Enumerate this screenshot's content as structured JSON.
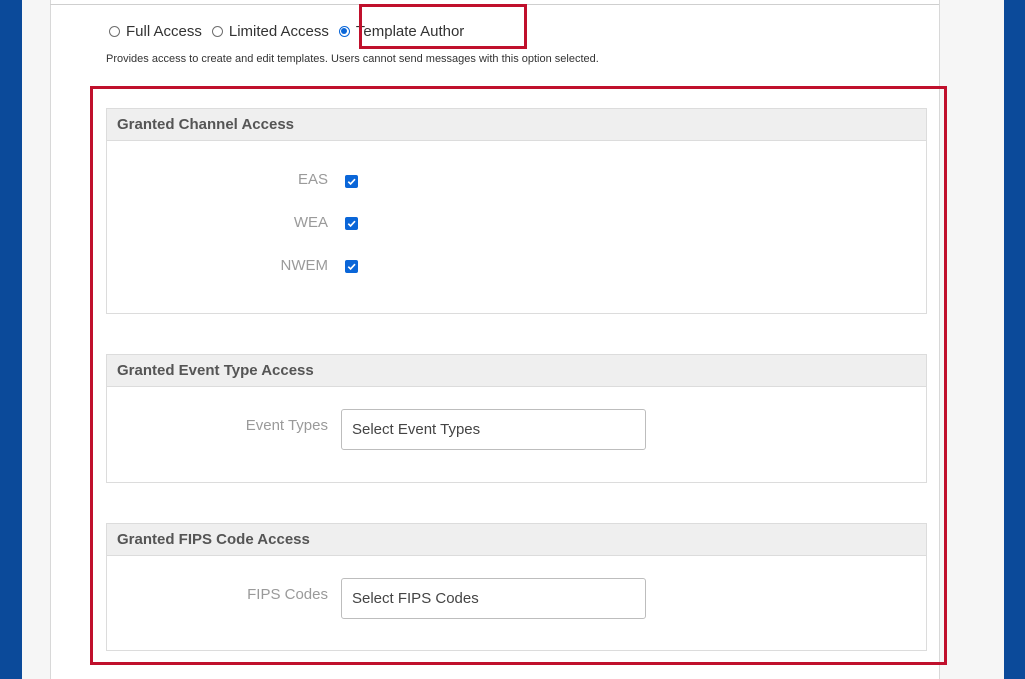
{
  "access_options": [
    {
      "label": "Full Access",
      "selected": false
    },
    {
      "label": "Limited Access",
      "selected": false
    },
    {
      "label": "Template Author",
      "selected": true
    }
  ],
  "description": "Provides access to create and edit templates. Users cannot send messages with this option selected.",
  "channel_panel": {
    "title": "Granted Channel Access",
    "channels": [
      {
        "label": "EAS",
        "checked": true
      },
      {
        "label": "WEA",
        "checked": true
      },
      {
        "label": "NWEM",
        "checked": true
      }
    ]
  },
  "event_panel": {
    "title": "Granted Event Type Access",
    "field_label": "Event Types",
    "placeholder": "Select Event Types"
  },
  "fips_panel": {
    "title": "Granted FIPS Code Access",
    "field_label": "FIPS Codes",
    "placeholder": "Select FIPS Codes"
  },
  "colors": {
    "highlight": "#c0102c",
    "accent": "#0a66d8",
    "background": "#0b4a9a"
  }
}
